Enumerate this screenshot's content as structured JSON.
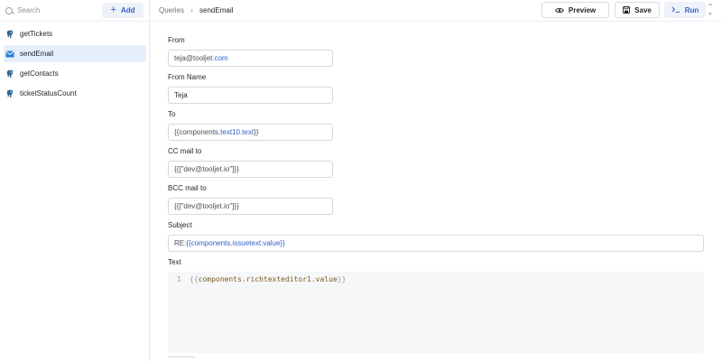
{
  "sidebar": {
    "search_placeholder": "Search",
    "add_label": "Add",
    "queries": [
      {
        "label": "getTickets",
        "icon": "postgres-icon"
      },
      {
        "label": "sendEmail",
        "icon": "mail-icon"
      },
      {
        "label": "getContacts",
        "icon": "postgres-icon"
      },
      {
        "label": "ticketStatusCount",
        "icon": "postgres-icon"
      }
    ],
    "active_index": 1
  },
  "header": {
    "breadcrumb_root": "Queries",
    "breadcrumb_current": "sendEmail",
    "preview_label": "Preview",
    "save_label": "Save",
    "run_label": "Run"
  },
  "form": {
    "from_label": "From",
    "from_value_user": "teja@tooljet",
    "from_value_tld": ".com",
    "from_name_label": "From Name",
    "from_name_value": "Teja",
    "to_label": "To",
    "to_value_open": "{{components.",
    "to_value_mid": "text10.text",
    "to_value_close": "}}",
    "cc_label": "CC mail to",
    "cc_value": "{{[\"dev@tooljet.io\"]}}",
    "bcc_label": "BCC mail to",
    "bcc_value": "{{[\"dev@tooljet.io\"]}}",
    "subject_label": "Subject",
    "subject_prefix": "RE: ",
    "subject_expr": "{{components.issuetext.value}}",
    "text_label": "Text",
    "text_line_number": "1",
    "text_open": "{{",
    "text_expr": "components.richtexteditor1.value",
    "text_close": "}}"
  },
  "colors": {
    "accent": "#3a5ccc",
    "active_bg": "#e7eefb",
    "postgres_blue": "#336791"
  }
}
